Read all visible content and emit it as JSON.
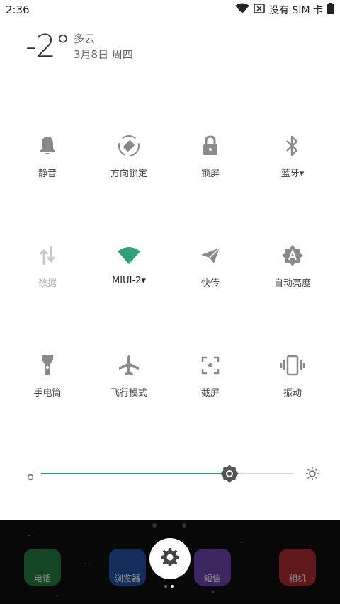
{
  "status_bar": {
    "time": "2:36",
    "no_sim_text": "没有 SIM 卡"
  },
  "weather": {
    "temperature": "-2°",
    "condition": "多云",
    "date": "3月8日 周四"
  },
  "tiles": [
    {
      "label": "静音"
    },
    {
      "label": "方向锁定"
    },
    {
      "label": "锁屏"
    },
    {
      "label": "蓝牙▾"
    },
    {
      "label": "数据"
    },
    {
      "label": "MIUI-2▾"
    },
    {
      "label": "快传"
    },
    {
      "label": "自动亮度"
    },
    {
      "label": "手电筒"
    },
    {
      "label": "飞行模式"
    },
    {
      "label": "截屏"
    },
    {
      "label": "振动"
    }
  ],
  "brightness": {
    "level": 0.75
  },
  "dock": {
    "apps": [
      {
        "label": "电话"
      },
      {
        "label": "浏览器"
      },
      {
        "label": "短信"
      },
      {
        "label": "相机"
      }
    ]
  },
  "colors": {
    "accent": "#2fa07a",
    "icon": "#8a8a8a"
  }
}
